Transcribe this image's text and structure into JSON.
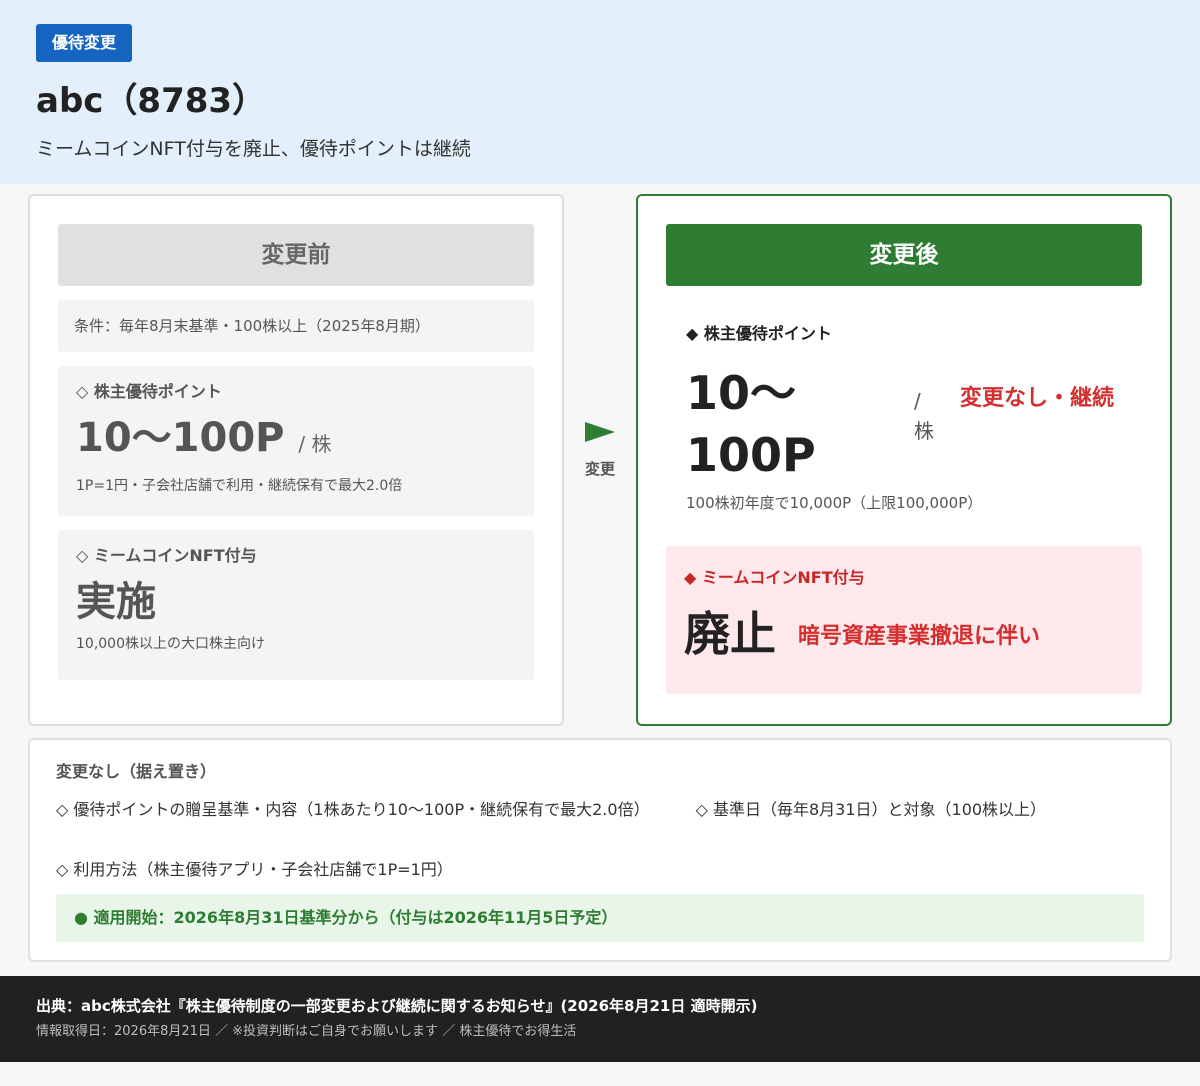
{
  "header": {
    "badge": "優待変更",
    "title": "abc（8783）",
    "subtitle": "ミームコインNFT付与を廃止、優待ポイントは継続"
  },
  "before": {
    "heading": "変更前",
    "condition": "条件：毎年8月末基準・100株以上（2025年8月期）",
    "points_label": "◇ 株主優待ポイント",
    "points_value": "10〜100P",
    "points_unit": "/ 株",
    "points_note": "1P=1円・子会社店舗で利用・継続保有で最大2.0倍",
    "nft_label": "◇ ミームコインNFT付与",
    "nft_value": "実施",
    "nft_note": "10,000株以上の大口株主向け"
  },
  "arrow": {
    "label": "変更"
  },
  "after": {
    "heading": "変更後",
    "points_label": "◆ 株主優待ポイント",
    "points_value": "10〜100P",
    "points_unit": "/ 株",
    "points_status": "変更なし・継続",
    "points_note": "100株初年度で10,000P（上限100,000P）",
    "nft_label": "◆ ミームコインNFT付与",
    "nft_value": "廃止",
    "nft_reason": "暗号資産事業撤退に伴い"
  },
  "unchanged": {
    "title": "変更なし（据え置き）",
    "items": [
      "◇ 優待ポイントの贈呈基準・内容（1株あたり10〜100P・継続保有で最大2.0倍）",
      "◇ 基準日（毎年8月31日）と対象（100株以上）",
      "◇ 利用方法（株主優待アプリ・子会社店舗で1P=1円）"
    ],
    "apply": "● 適用開始：2026年8月31日基準分から（付与は2026年11月5日予定）"
  },
  "footer": {
    "source": "出典：abc株式会社『株主優待制度の一部変更および継続に関するお知らせ』(2026年8月21日 適時開示)",
    "meta": "情報取得日：2026年8月21日 ／ ※投資判断はご自身でお願いします ／ 株主優待でお得生活"
  }
}
